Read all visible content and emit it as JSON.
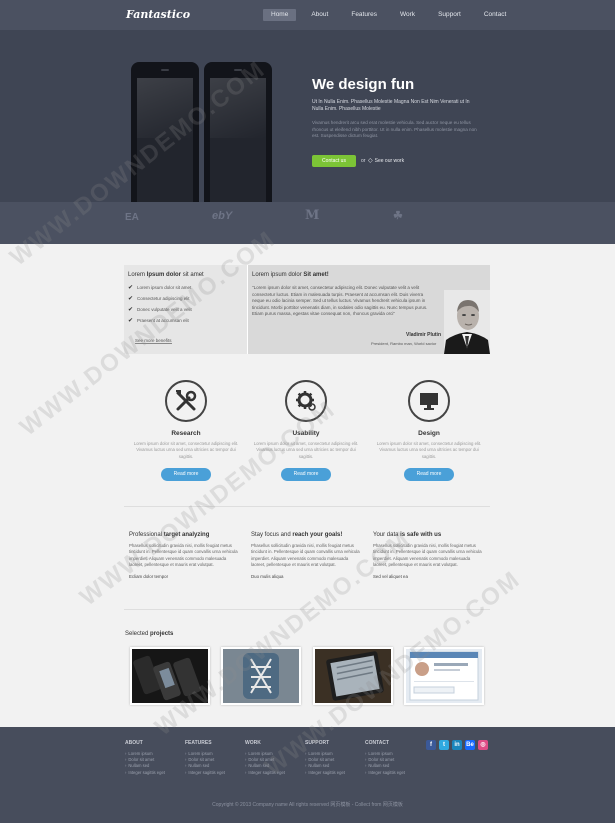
{
  "header": {
    "logo": "Fantastico",
    "nav": [
      "Home",
      "About",
      "Features",
      "Work",
      "Support",
      "Contact"
    ]
  },
  "hero": {
    "title": "We design fun",
    "lead": "Ut In Nulla Enim. Phasellus Molestie Magna Non Est Nim Venerati ut In Nulla Enim. Phasellus Molestie",
    "text": "Vivamus hendrerit arcu sed erat molestie vehicula. Sed auctor neque eu tellus rhoncus ut eleifend nibh porttitor. Ut in nulla enim. Phasellus molestie magna non est. Suspendisse dictum feugiat.",
    "contact_label": "Contact us",
    "or_label": "or",
    "work_label": "See our work"
  },
  "brands": [
    "EA",
    "ebY",
    "M",
    "☘"
  ],
  "feature_box": {
    "left_title_pre": "Lorem ",
    "left_title_bold": "Ipsum dolor",
    "left_title_post": " sit amet",
    "items": [
      "Lorem ipsum dolor sit amet",
      "Consectetur adipiscing elit",
      "Donec vulputate velit a velit",
      "Praesent at accumsan elit"
    ],
    "see_more": "See more benefits",
    "right_title_pre": "Lorem ipsum dolor ",
    "right_title_bold": "Sit amet!",
    "quote": "\"Lorem ipsum dolor sit amet, consectetur adipiscing elit. Donec vulputate velit a velit consectetur luctus. Etiam in malesuada turpis. Praesent at accumsan elit. Duis viverra neque eu odio lacinia semper. Sed ut tellus luctus. Vivamus hendrerit vehicula ipsum in tincidunt. Morbi porttitor venenatis diam, in sodales odio sagittis eu. Nunc tempus purus. Etiam purus massa, egestas vitae consequat non, rhoncus gravida orci\"",
    "quote_name": "Vladimir Plutin",
    "quote_role": "President, Rambo man, World savior"
  },
  "services": [
    {
      "title": "Research",
      "text": "Lorem ipsum dolor sit amet, consectetur adipiscing elit. Vivamus luctus urna sed urna ultricies ac tempor dui sagittis.",
      "button": "Read more"
    },
    {
      "title": "Usability",
      "text": "Lorem ipsum dolor sit amet, consectetur adipiscing elit. Vivamus luctus urna sed urna ultricies ac tempor dui sagittis.",
      "button": "Read more"
    },
    {
      "title": "Design",
      "text": "Lorem ipsum dolor sit amet, consectetur adipiscing elit. Vivamus luctus urna sed urna ultricies ac tempor dui sagittis.",
      "button": "Read more"
    }
  ],
  "columns": [
    {
      "title_pre": "Professional ",
      "title_bold": "target analyzing",
      "text": "Phasellus sollicitudin gravida nisi, mollis feugiat metus tincidunt in. Pellentesque id quam convallis urna vehicula imperdiet. Aliquam venenatis commodo malesuada laoreet, pellentesque et mauris erat volutpat.",
      "link": "Ecliam dolor tempor"
    },
    {
      "title_pre": "Stay focus and ",
      "title_bold": "reach your goals!",
      "text": "Phasellus sollicitudin gravida nisi, mollis feugiat metus tincidunt in. Pellentesque id quam convallis urna vehicula imperdiet. Aliquam venenatis commodo malesuada laoreet, pellentesque et mauris erat volutpat.",
      "link": "Duo mulis aliqua"
    },
    {
      "title_pre": "Your data ",
      "title_bold": "is safe with us",
      "text": "Phasellus sollicitudin gravida nisi, mollis feugiat metus tincidunt in. Pellentesque id quam convallis urna vehicula imperdiet. Aliquam venenatis commodo malesuada laoreet, pellentesque et mauris erat volutpat.",
      "link": "Sed vel aliquet ea"
    }
  ],
  "projects": {
    "title_pre": "Selected ",
    "title_bold": "projects"
  },
  "footer": {
    "columns": [
      {
        "title": "ABOUT",
        "items": [
          "Lorem ipsum",
          "Dolor sit amet",
          "Nullam sed",
          "Integer sagittis eget"
        ]
      },
      {
        "title": "FEATURES",
        "items": [
          "Lorem ipsum",
          "Dolor sit amet",
          "Nullam sed",
          "Integer sagittis eget"
        ]
      },
      {
        "title": "WORK",
        "items": [
          "Lorem ipsum",
          "Dolor sit amet",
          "Nullam sed",
          "Integer sagittis eget"
        ]
      },
      {
        "title": "SUPPORT",
        "items": [
          "Lorem ipsum",
          "Dolor sit amet",
          "Nullam sed",
          "Integer sagittis eget"
        ]
      },
      {
        "title": "CONTACT",
        "items": [
          "Lorem ipsum",
          "Dolor sit amet",
          "Nullam sed",
          "Integer sagittis eget"
        ]
      }
    ],
    "social": [
      {
        "icon": "facebook-icon",
        "glyph": "f",
        "color": "#3b5998"
      },
      {
        "icon": "twitter-icon",
        "glyph": "t",
        "color": "#2fa9e0"
      },
      {
        "icon": "linkedin-icon",
        "glyph": "in",
        "color": "#1b86bc"
      },
      {
        "icon": "behance-icon",
        "glyph": "Be",
        "color": "#1769ff"
      },
      {
        "icon": "dribbble-icon",
        "glyph": "◎",
        "color": "#e04c86"
      }
    ],
    "copyright": "Copyright © 2013 Company name All rights reserved 网页模板 - Collect from 网页模板"
  },
  "watermark": "WWW.DOWNDEMO.COM",
  "colors": {
    "accent_green": "#7cc436",
    "accent_blue": "#4aa0d8",
    "header_bg": "#4b5161",
    "hero_bg": "#3f4554",
    "footer_bg": "#474d5c"
  }
}
